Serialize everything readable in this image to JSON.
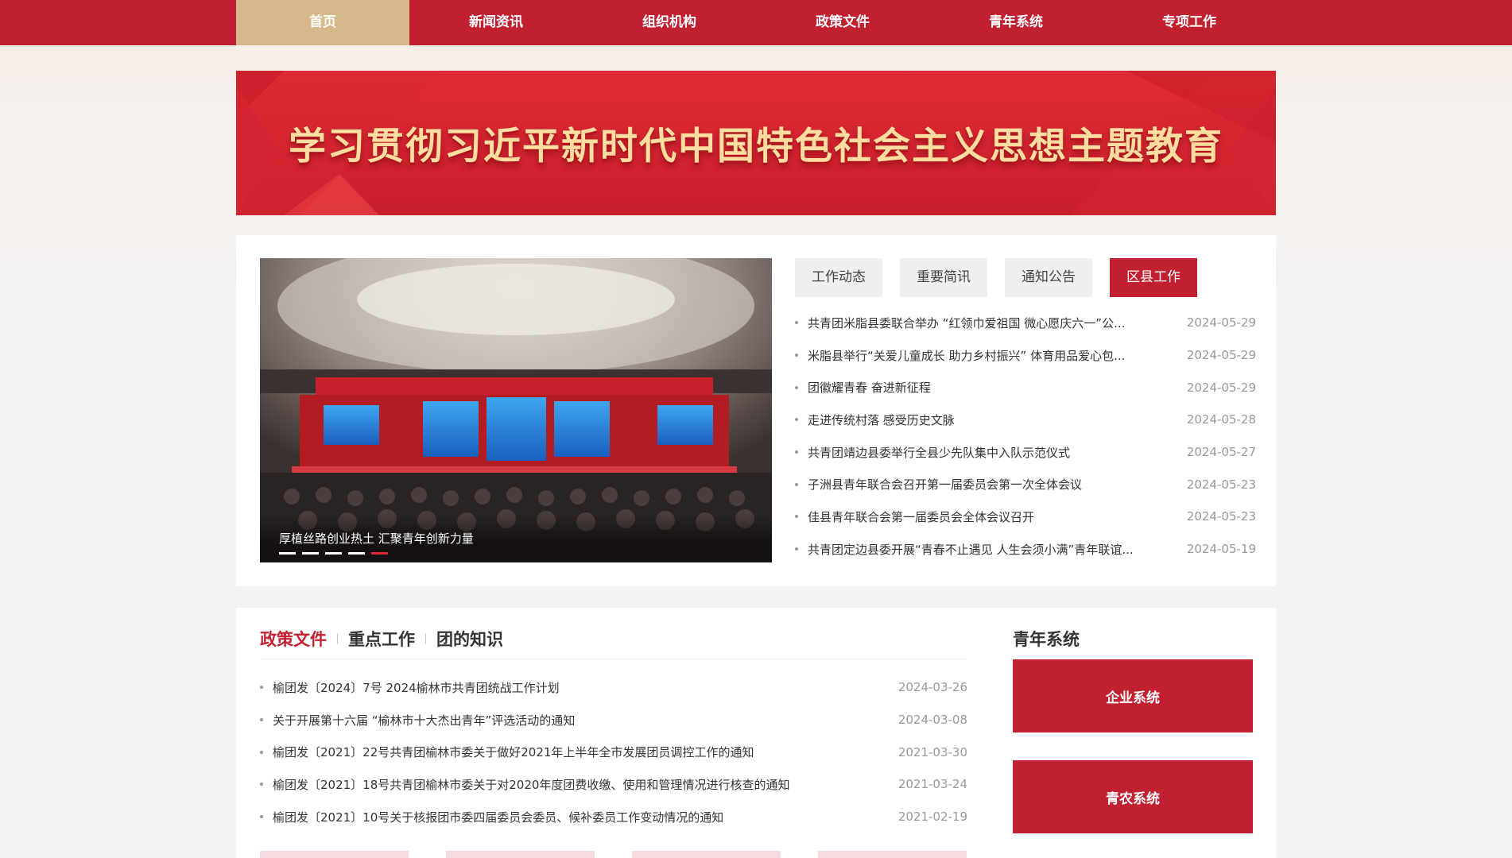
{
  "nav": {
    "items": [
      "首页",
      "新闻资讯",
      "组织机构",
      "政策文件",
      "青年系统",
      "专项工作"
    ],
    "active_index": 0
  },
  "banner": {
    "title": "学习贯彻习近平新时代中国特色社会主义思想主题教育"
  },
  "carousel": {
    "caption": "厚植丝路创业热土 汇聚青年创新力量",
    "slide_count": 5,
    "active_slide": 5
  },
  "news": {
    "tabs": [
      "工作动态",
      "重要简讯",
      "通知公告",
      "区县工作"
    ],
    "active_tab": 3,
    "items": [
      {
        "title": "共青团米脂县委联合举办 “红领巾爱祖国 微心愿庆六一”公...",
        "date": "2024-05-29"
      },
      {
        "title": "米脂县举行“关爱儿童成长 助力乡村振兴” 体育用品爱心包...",
        "date": "2024-05-29"
      },
      {
        "title": "团徽耀青春 奋进新征程",
        "date": "2024-05-29"
      },
      {
        "title": "走进传统村落 感受历史文脉",
        "date": "2024-05-28"
      },
      {
        "title": "共青团靖边县委举行全县少先队集中入队示范仪式",
        "date": "2024-05-27"
      },
      {
        "title": "子洲县青年联合会召开第一届委员会第一次全体会议",
        "date": "2024-05-23"
      },
      {
        "title": "佳县青年联合会第一届委员会全体会议召开",
        "date": "2024-05-23"
      },
      {
        "title": "共青团定边县委开展“青春不止遇见 人生会须小满”青年联谊...",
        "date": "2024-05-19"
      }
    ]
  },
  "policy": {
    "tabs": [
      "政策文件",
      "重点工作",
      "团的知识"
    ],
    "active_tab": 0,
    "items": [
      {
        "title": "榆团发〔2024〕7号 2024榆林市共青团统战工作计划",
        "date": "2024-03-26"
      },
      {
        "title": "关于开展第十六届 “榆林市十大杰出青年”评选活动的通知",
        "date": "2024-03-08"
      },
      {
        "title": "榆团发〔2021〕22号共青团榆林市委关于做好2021年上半年全市发展团员调控工作的通知",
        "date": "2021-03-30"
      },
      {
        "title": "榆团发〔2021〕18号共青团榆林市委关于对2020年度团费收缴、使用和管理情况进行核查的通知",
        "date": "2021-03-24"
      },
      {
        "title": "榆团发〔2021〕10号关于核报团市委四届委员会委员、候补委员工作变动情况的通知",
        "date": "2021-02-19"
      }
    ]
  },
  "youth_system": {
    "title": "青年系统",
    "buttons": [
      "企业系统",
      "青农系统"
    ]
  },
  "colors": {
    "brand_red": "#c0202f",
    "nav_active_gold": "#d6b98a",
    "banner_text_gold": "#ffdca0"
  }
}
